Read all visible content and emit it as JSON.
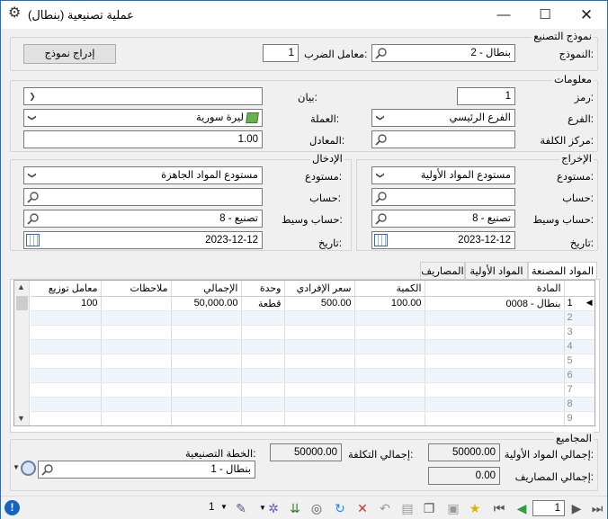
{
  "window": {
    "title": "عملية تصنيعية (بنطال)"
  },
  "template_section": {
    "title": "نموذج التصنيع",
    "template_label": "النموذج:",
    "template_value": "2 - بنطال",
    "multiplier_label": "معامل الضرب:",
    "multiplier_value": "1",
    "insert_button": "إدراج نموذج"
  },
  "info_section": {
    "title": "معلومات",
    "code_label": "رمز:",
    "code_value": "1",
    "statement_label": "بيان:",
    "statement_value": "",
    "branch_label": "الفرع:",
    "branch_value": "الفرع الرئيسي",
    "currency_label": "العملة:",
    "currency_value": "ليرة سورية",
    "cost_center_label": "مركز الكلفة:",
    "cost_center_value": "",
    "equivalent_label": "المعادل:",
    "equivalent_value": "1.00"
  },
  "output_section": {
    "title": "الإخراج",
    "warehouse_label": "مستودع:",
    "warehouse_value": "مستودع المواد الأولية",
    "account_label": "حساب:",
    "account_value": "",
    "intermediate_label": "حساب وسيط:",
    "intermediate_value": "8 - تصنيع",
    "date_label": "تاريخ:",
    "date_value": "2023-12-12"
  },
  "input_section": {
    "title": "الإدخال",
    "warehouse_label": "مستودع:",
    "warehouse_value": "مستودع المواد الجاهزة",
    "account_label": "حساب:",
    "account_value": "",
    "intermediate_label": "حساب وسيط:",
    "intermediate_value": "8 - تصنيع",
    "date_label": "تاريخ:",
    "date_value": "2023-12-12"
  },
  "tabs": [
    "المواد المصنعة",
    "المواد الأولية",
    "المصاريف"
  ],
  "grid": {
    "columns": [
      "المادة",
      "الكمية",
      "سعر الإفرادي",
      "وحدة",
      "الإجمالي",
      "ملاحظات",
      "معامل توزيع"
    ],
    "rows": [
      {
        "num": "1",
        "material": "0008 - بنطال",
        "qty": "100.00",
        "price": "500.00",
        "unit": "قطعة",
        "total": "50,000.00",
        "notes": "",
        "factor": "100"
      },
      {
        "num": "2",
        "material": "",
        "qty": "",
        "price": "",
        "unit": "",
        "total": "",
        "notes": "",
        "factor": ""
      },
      {
        "num": "3",
        "material": "",
        "qty": "",
        "price": "",
        "unit": "",
        "total": "",
        "notes": "",
        "factor": ""
      },
      {
        "num": "4",
        "material": "",
        "qty": "",
        "price": "",
        "unit": "",
        "total": "",
        "notes": "",
        "factor": ""
      },
      {
        "num": "5",
        "material": "",
        "qty": "",
        "price": "",
        "unit": "",
        "total": "",
        "notes": "",
        "factor": ""
      },
      {
        "num": "6",
        "material": "",
        "qty": "",
        "price": "",
        "unit": "",
        "total": "",
        "notes": "",
        "factor": ""
      },
      {
        "num": "7",
        "material": "",
        "qty": "",
        "price": "",
        "unit": "",
        "total": "",
        "notes": "",
        "factor": ""
      },
      {
        "num": "8",
        "material": "",
        "qty": "",
        "price": "",
        "unit": "",
        "total": "",
        "notes": "",
        "factor": ""
      },
      {
        "num": "9",
        "material": "",
        "qty": "",
        "price": "",
        "unit": "",
        "total": "",
        "notes": "",
        "factor": ""
      }
    ]
  },
  "totals": {
    "title": "المجاميع",
    "raw_total_label": "إجمالي المواد الأولية:",
    "raw_total_value": "50000.00",
    "expenses_label": "إجمالي المصاريف:",
    "expenses_value": "0.00",
    "cost_total_label": "إجمالي التكلفة:",
    "cost_total_value": "50000.00",
    "plan_label": "الخطة التصنيعية:",
    "plan_value": "1 - بنطال"
  },
  "statusbar": {
    "page_value": "1",
    "count_value": "1"
  }
}
